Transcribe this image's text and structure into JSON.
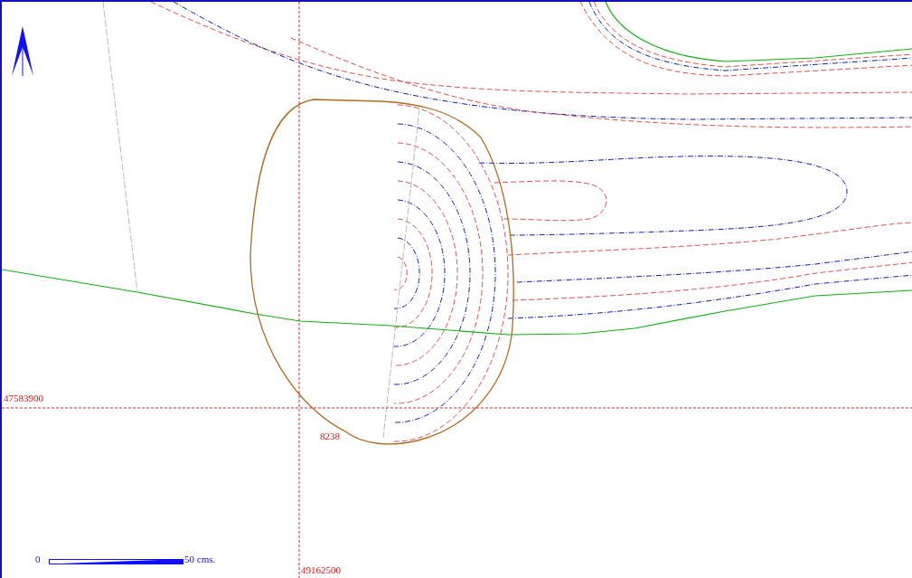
{
  "grid": {
    "northing_label": "47583900",
    "easting_label": "49162500"
  },
  "feature_label": "8238",
  "scale_bar": {
    "start_label": "0",
    "end_label": "50 cms."
  }
}
